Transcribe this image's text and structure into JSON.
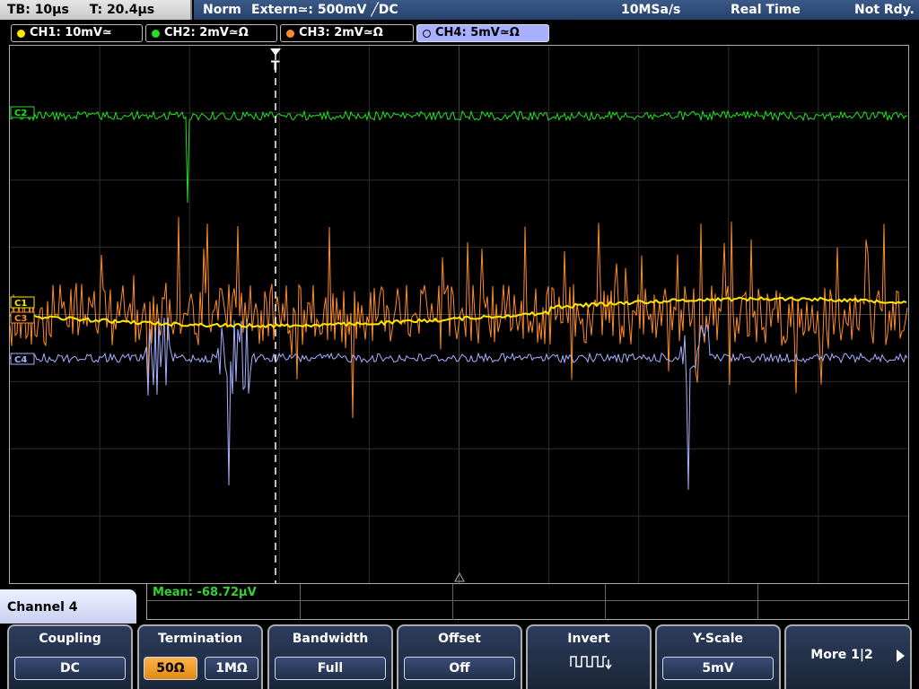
{
  "header": {
    "timebase": "TB: 10µs",
    "trigger_time": "T: 20.4µs",
    "trigger_mode": "Norm",
    "trigger_source": "Extern≃: 500mV ╱DC",
    "sample_rate": "10MSa/s",
    "acq_mode": "Real Time",
    "status": "Not Rdy."
  },
  "channels": [
    {
      "label": "CH1: 10mV≃",
      "color": "#ffe800"
    },
    {
      "label": "CH2: 2mV≃Ω",
      "color": "#22e022"
    },
    {
      "label": "CH3: 2mV≃Ω",
      "color": "#ff8c2a"
    },
    {
      "label": "CH4: 5mV≃Ω",
      "color": "#a8b0ff"
    }
  ],
  "markers": {
    "ch2": "C2",
    "ch1": "C1",
    "ch3": "C3",
    "ch4": "C4",
    "trigger": "T"
  },
  "measurement": {
    "text": "Mean: -68.72µV"
  },
  "menu": {
    "title": "Channel 4",
    "softkeys": {
      "coupling": {
        "label": "Coupling",
        "value": "DC"
      },
      "termination": {
        "label": "Termination",
        "option1": "50Ω",
        "option2": "1MΩ",
        "selected": "50Ω"
      },
      "bandwidth": {
        "label": "Bandwidth",
        "value": "Full"
      },
      "offset": {
        "label": "Offset",
        "value": "Off"
      },
      "invert": {
        "label": "Invert",
        "icon": "invert-square-wave-icon"
      },
      "yscale": {
        "label": "Y-Scale",
        "value": "5mV"
      },
      "more": {
        "label": "More 1|2"
      }
    }
  },
  "colors": {
    "grid": "#2e2e2e",
    "accent": "#a8b0ff",
    "status_bar": "#2c4a78",
    "measurement": "#34d234"
  }
}
